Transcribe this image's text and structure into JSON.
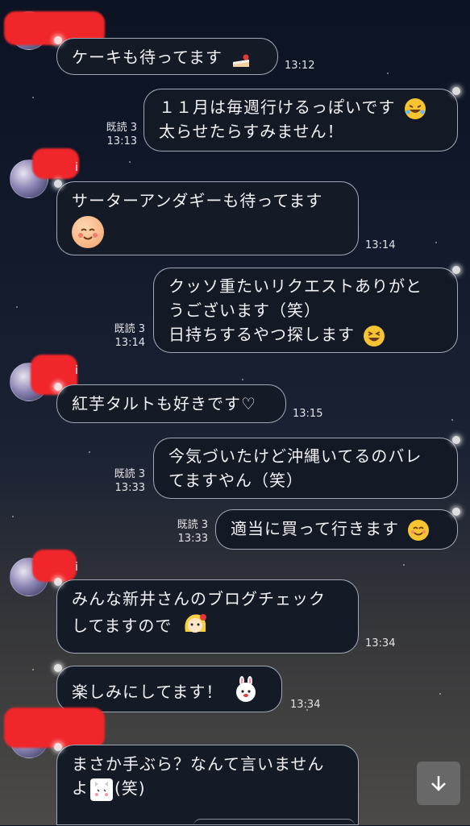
{
  "chat": {
    "messages": [
      {
        "side": "recv",
        "text": [
          "ケーキも待ってます"
        ],
        "time": "13:12"
      },
      {
        "side": "sent",
        "text": [
          "１１月は毎週行けるっぽいです",
          "太らせたらすみません！"
        ],
        "read": "既読 3",
        "time": "13:13"
      },
      {
        "side": "recv",
        "sender_suffix": "i",
        "text": [
          "サーターアンダギーも待ってます"
        ],
        "time": "13:14"
      },
      {
        "side": "sent",
        "text": [
          "クッソ重たいリクエストありがと",
          "うございます（笑）",
          "日持ちするやつ探します"
        ],
        "read": "既読 3",
        "time": "13:14"
      },
      {
        "side": "recv",
        "sender_suffix": "i",
        "text": [
          "紅芋タルトも好きです♡"
        ],
        "time": "13:15"
      },
      {
        "side": "sent",
        "text": [
          "今気づいたけど沖縄いてるのバレ",
          "てますやん（笑）"
        ],
        "read": "既読 3",
        "time": "13:33"
      },
      {
        "side": "sent",
        "text": [
          "適当に買って行きます"
        ],
        "read": "既読 3",
        "time": "13:33"
      },
      {
        "side": "recv",
        "sender_suffix": "i",
        "text": [
          "みんな新井さんのブログチェック",
          "してますので"
        ],
        "time": "13:34"
      },
      {
        "side": "recv",
        "text": [
          "楽しみにしてます！"
        ],
        "time": "13:34"
      },
      {
        "side": "recv",
        "text": [
          "まさか手ぶら？なんて言いません",
          "よ"
        ],
        "text_suffix": "(笑)"
      }
    ]
  },
  "icons": {
    "scroll_down": "arrow-down-icon",
    "colors": {
      "bubble_bg": "#151a27",
      "bubble_border": "#d2d7e6",
      "redaction": "#f0262a"
    }
  }
}
